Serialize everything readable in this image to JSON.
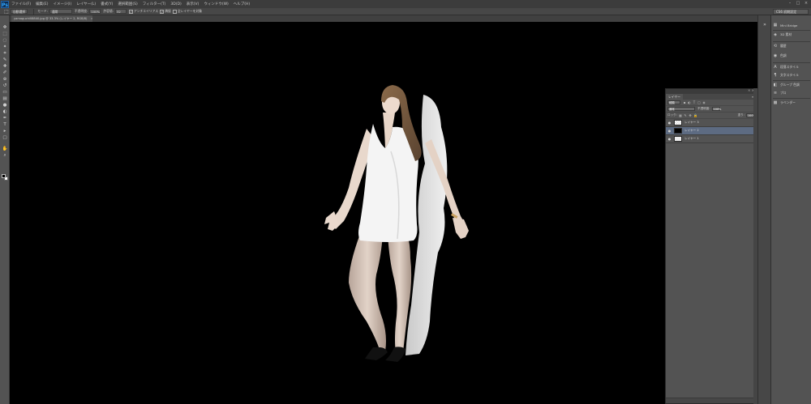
{
  "app": {
    "logo": "Ps",
    "menu": [
      "ファイル(F)",
      "編集(E)",
      "イメージ(I)",
      "レイヤー(L)",
      "書式(Y)",
      "選択範囲(S)",
      "フィルター(T)",
      "3D(D)",
      "表示(V)",
      "ウィンドウ(W)",
      "ヘルプ(H)"
    ],
    "window_controls": [
      "–",
      "□",
      "×"
    ]
  },
  "options": {
    "tool_icon": "marquee-tool",
    "tool_glyph": "⬚",
    "preset_label": "自動選択",
    "mode_label": "モード:",
    "mode_value": "通常",
    "opacity_label": "不透明度:",
    "opacity_value": "100%",
    "tolerance_label": "許容値:",
    "tolerance_value": "32",
    "antialias_label": "アンチエイリアス",
    "contiguous_label": "隣接",
    "sample_all_label": "全レイヤーを対象",
    "workspace": "CS6 初期設定"
  },
  "document": {
    "tab_title": "yamaguchi08840.jpg @ 33.3% (レイヤー 2, RGB/8)",
    "tab_close": "×"
  },
  "tools": [
    {
      "name": "move-tool",
      "glyph": "✥"
    },
    {
      "name": "marquee-tool",
      "glyph": "⬚"
    },
    {
      "name": "lasso-tool",
      "glyph": "◌"
    },
    {
      "name": "quick-select-tool",
      "glyph": "✦"
    },
    {
      "name": "crop-tool",
      "glyph": "⌗"
    },
    {
      "name": "eyedropper-tool",
      "glyph": "✎"
    },
    {
      "name": "healing-tool",
      "glyph": "✚"
    },
    {
      "name": "brush-tool",
      "glyph": "✐"
    },
    {
      "name": "clone-stamp-tool",
      "glyph": "⊕"
    },
    {
      "name": "history-brush-tool",
      "glyph": "↺"
    },
    {
      "name": "eraser-tool",
      "glyph": "▭"
    },
    {
      "name": "gradient-tool",
      "glyph": "▤"
    },
    {
      "name": "blur-tool",
      "glyph": "●"
    },
    {
      "name": "dodge-tool",
      "glyph": "◐"
    },
    {
      "name": "pen-tool",
      "glyph": "✒"
    },
    {
      "name": "type-tool",
      "glyph": "T"
    },
    {
      "name": "path-select-tool",
      "glyph": "▸"
    },
    {
      "name": "shape-tool",
      "glyph": "▢"
    },
    {
      "name": "hand-tool",
      "glyph": "✋"
    },
    {
      "name": "zoom-tool",
      "glyph": "⌕"
    }
  ],
  "right_panels": {
    "collapse": "»",
    "items": [
      {
        "name": "mini-bridge",
        "glyph": "▦",
        "label": "Mini Bridge"
      },
      {
        "name": "3d-material",
        "glyph": "◈",
        "label": "3D 素材"
      },
      {
        "name": "history",
        "glyph": "⟲",
        "label": "履歴"
      },
      {
        "name": "color",
        "glyph": "◉",
        "label": "色調"
      },
      {
        "name": "character-style",
        "glyph": "A",
        "label": "段落スタイル"
      },
      {
        "name": "paragraph-style",
        "glyph": "¶",
        "label": "文字スタイル"
      },
      {
        "name": "adjustments",
        "glyph": "◧",
        "label": "グループ 色調"
      },
      {
        "name": "properties",
        "glyph": "≡",
        "label": "プロ"
      },
      {
        "name": "swatches",
        "glyph": "▩",
        "label": "ラベンダー"
      }
    ]
  },
  "layers_panel": {
    "close": "× ×",
    "tab": "レイヤー",
    "menu": "≡",
    "filter_kind": "種類",
    "blend_mode": "通常",
    "opacity_label": "不透明度:",
    "opacity_value": "100%",
    "lock_label": "ロック:",
    "fill_label": "塗り:",
    "fill_value": "100%",
    "filter_icons": [
      "▪",
      "◐",
      "T",
      "▢",
      "◈"
    ],
    "lock_icons": [
      "▦",
      "✎",
      "✥",
      "🔒"
    ],
    "eye": "●",
    "layers": [
      {
        "name": "レイヤー 3",
        "thumb": "checker",
        "selected": false
      },
      {
        "name": "レイヤー 2",
        "thumb": "black",
        "selected": true
      },
      {
        "name": "レイヤー 1",
        "thumb": "white",
        "selected": false
      }
    ]
  },
  "colors": {
    "ui_dark": "#535353",
    "canvas": "#000000",
    "selection": "#5d6b82"
  }
}
